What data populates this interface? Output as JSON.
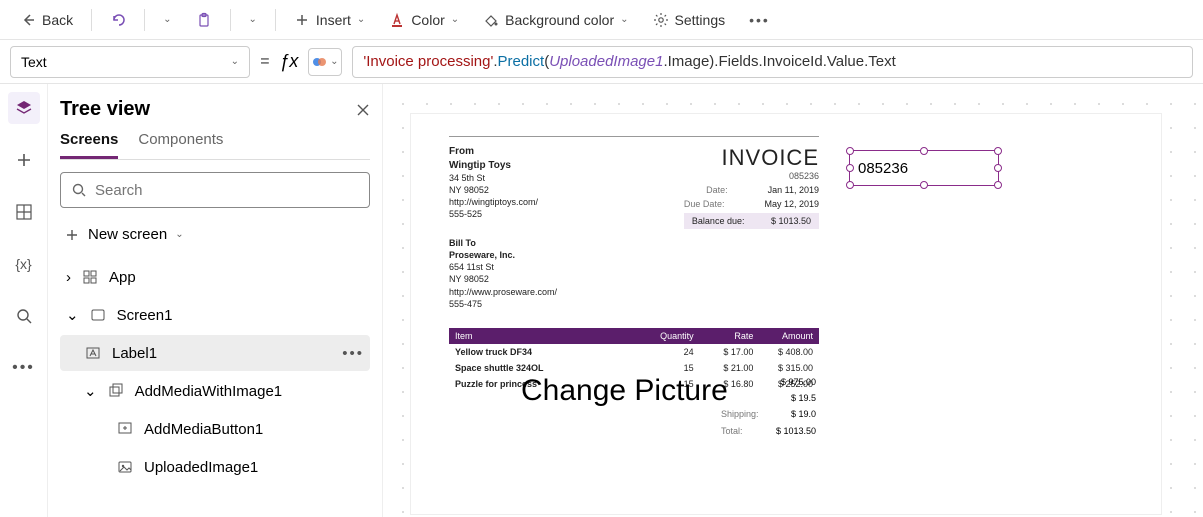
{
  "toolbar": {
    "back": "Back",
    "insert": "Insert",
    "color": "Color",
    "bgcolor": "Background color",
    "settings": "Settings"
  },
  "formula": {
    "property": "Text",
    "parts": {
      "p1": "'Invoice processing'",
      "p2": ".",
      "fn": "Predict",
      "p3": "(",
      "var": "UploadedImage1",
      "p4": ".Image).Fields.InvoiceId.Value.Text"
    }
  },
  "tree": {
    "title": "Tree view",
    "tabs": {
      "screens": "Screens",
      "components": "Components"
    },
    "search_ph": "Search",
    "new_screen": "New screen",
    "app": "App",
    "screen1": "Screen1",
    "label1": "Label1",
    "addMedia": "AddMediaWithImage1",
    "addMediaBtn": "AddMediaButton1",
    "uploaded": "UploadedImage1"
  },
  "rail": {
    "vars": "{x}"
  },
  "invoice": {
    "from_label": "From",
    "from_name": "Wingtip Toys",
    "from_addr1": "34 5th St",
    "from_addr2": "NY 98052",
    "from_url": "http://wingtiptoys.com/",
    "from_phone": "555-525",
    "title": "INVOICE",
    "number": "085236",
    "date_l": "Date:",
    "date_v": "Jan 11, 2019",
    "due_l": "Due Date:",
    "due_v": "May 12, 2019",
    "bal_l": "Balance due:",
    "bal_v": "$ 1013.50",
    "billto_label": "Bill To",
    "billto_name": "Proseware, Inc.",
    "billto_addr1": "654 11st St",
    "billto_addr2": "NY 98052",
    "billto_url": "http://www.proseware.com/",
    "billto_phone": "555-475",
    "cols": {
      "item": "Item",
      "qty": "Quantity",
      "rate": "Rate",
      "amt": "Amount"
    },
    "rows": [
      {
        "item": "Yellow truck DF34",
        "qty": "24",
        "rate": "$ 17.00",
        "amt": "$ 408.00"
      },
      {
        "item": "Space shuttle 324OL",
        "qty": "15",
        "rate": "$ 21.00",
        "amt": "$ 315.00"
      },
      {
        "item": "Puzzle for princess",
        "qty": "15",
        "rate": "$ 16.80",
        "amt": "$ 252.00"
      }
    ],
    "change_picture": "Change Picture",
    "t1": "$ 975.00",
    "t2": "$ 19.5",
    "ship_l": "Shipping:",
    "ship_v": "$ 19.0",
    "tot_l": "Total:",
    "tot_v": "$ 1013.50"
  },
  "label_value": "085236"
}
